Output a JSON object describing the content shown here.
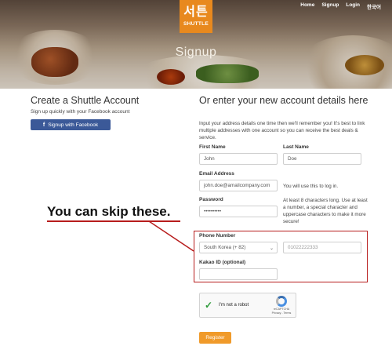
{
  "brand": {
    "logo_glyph": "서튼",
    "logo_word": "SHUTTLE",
    "accent": "#e8891e"
  },
  "nav": {
    "items": [
      "Home",
      "Signup",
      "Login",
      "한국어"
    ]
  },
  "hero": {
    "title": "Signup"
  },
  "left": {
    "title": "Create a Shuttle Account",
    "subtitle": "Sign up quickly with your Facebook account",
    "fb_button": "Signup with Facebook",
    "fb_color": "#3b5998"
  },
  "annotation": {
    "text": "You can skip these.",
    "color": "#b71c1c"
  },
  "right": {
    "title": "Or enter your new account details here",
    "description": "Input your address details one time then we'll remember you! It's best to link multiple addresses with one account so you can receive the best deals & service."
  },
  "form": {
    "first_name": {
      "label": "First Name",
      "placeholder": "John"
    },
    "last_name": {
      "label": "Last Name",
      "placeholder": "Doe"
    },
    "email": {
      "label": "Email Address",
      "placeholder": "john.doe@amailcompany.com",
      "hint": "You will use this to log in."
    },
    "password": {
      "label": "Password",
      "value": "••••••••••",
      "hint": "At least 8 characters long. Use at least a number, a special character and uppercase characters to make it more secure!"
    },
    "phone": {
      "label": "Phone Number",
      "country": "South Korea (+ 82)",
      "placeholder": "01022222333"
    },
    "kakao": {
      "label": "Kakao ID (optional)",
      "placeholder": ""
    }
  },
  "captcha": {
    "label": "I'm not a robot",
    "brand": "reCAPTCHA",
    "links": "Privacy - Terms"
  },
  "register_button": "Register"
}
